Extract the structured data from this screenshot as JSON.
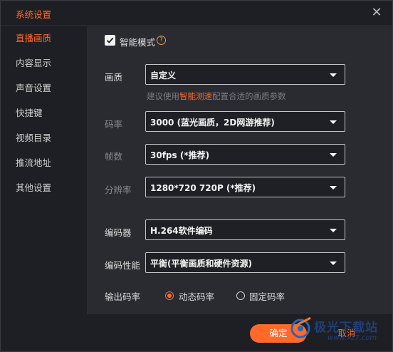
{
  "window": {
    "title": "系统设置"
  },
  "sidebar": {
    "items": [
      {
        "label": "直播画质",
        "active": true
      },
      {
        "label": "内容显示",
        "active": false
      },
      {
        "label": "声音设置",
        "active": false
      },
      {
        "label": "快捷键",
        "active": false
      },
      {
        "label": "视频目录",
        "active": false
      },
      {
        "label": "推流地址",
        "active": false
      },
      {
        "label": "其他设置",
        "active": false
      }
    ]
  },
  "smart_mode": {
    "label": "智能模式",
    "checked": true,
    "help_glyph": "?"
  },
  "settings": {
    "quality": {
      "label": "画质",
      "value": "自定义"
    },
    "hint": {
      "prefix": "建议使用",
      "link": "智能测速",
      "suffix": "配置合适的画质参数"
    },
    "bitrate": {
      "label": "码率",
      "value": "3000 (蓝光画质，2D网游推荐)"
    },
    "framerate": {
      "label": "帧数",
      "value": "30fps (*推荐)"
    },
    "resolution": {
      "label": "分辨率",
      "value": "1280*720 720P (*推荐)"
    },
    "encoder": {
      "label": "编码器",
      "value": "H.264软件编码"
    },
    "encoder_perf": {
      "label": "编码性能",
      "value": "平衡(平衡画质和硬件资源)"
    },
    "output_bitrate": {
      "label": "输出码率",
      "options": [
        {
          "label": "动态码率",
          "selected": true
        },
        {
          "label": "固定码率",
          "selected": false
        }
      ]
    }
  },
  "footer": {
    "ok_label": "确定",
    "cancel_label": "取消"
  },
  "watermark": {
    "text": "极光下载站",
    "url": "www.xz7.com"
  },
  "colors": {
    "accent": "#ff6a2b",
    "background": "#1e1f24",
    "panel": "#2a2b31"
  }
}
